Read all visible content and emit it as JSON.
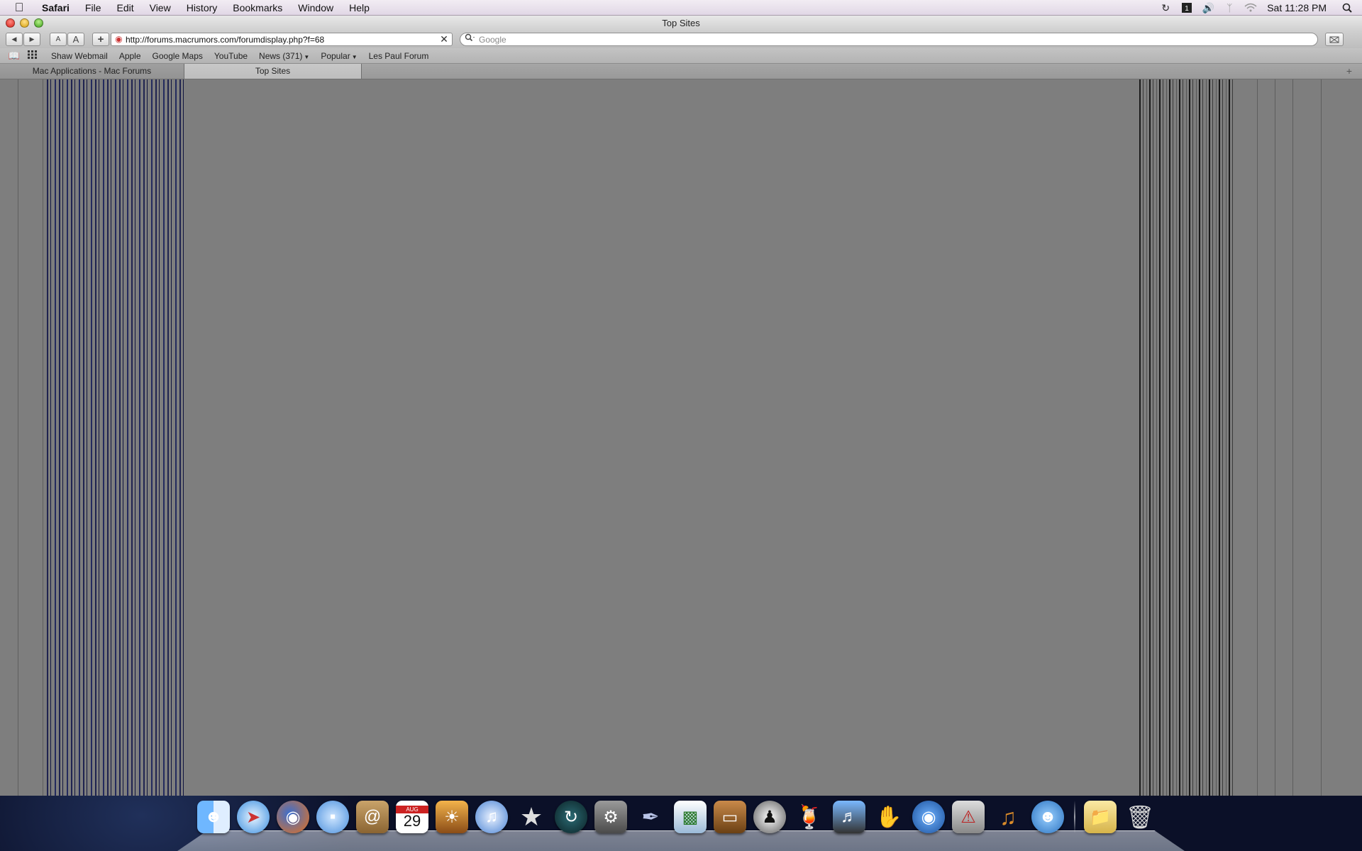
{
  "menubar": {
    "app_name": "Safari",
    "items": [
      "File",
      "Edit",
      "View",
      "History",
      "Bookmarks",
      "Window",
      "Help"
    ],
    "clock": "Sat 11:28 PM",
    "status_icons": [
      "time-machine-icon",
      "spaces-icon",
      "volume-icon",
      "bluetooth-icon",
      "wifi-icon",
      "spotlight-icon"
    ]
  },
  "window": {
    "title": "Top Sites"
  },
  "toolbar": {
    "back_label": "◀",
    "forward_label": "▶",
    "text_smaller_label": "A",
    "text_larger_label": "A",
    "add_bookmark_label": "+",
    "url": "http://forums.macrumors.com/forumdisplay.php?f=68",
    "search_placeholder": "Google"
  },
  "bookmarks": {
    "items": [
      "Shaw Webmail",
      "Apple",
      "Google Maps",
      "YouTube",
      "News (371)",
      "Popular",
      "Les Paul Forum"
    ]
  },
  "tabs": [
    {
      "label": "Mac Applications - Mac Forums",
      "active": false
    },
    {
      "label": "Top Sites",
      "active": true
    }
  ],
  "dock": {
    "items": [
      "finder-icon",
      "safari-icon",
      "firefox-icon",
      "ichat-icon",
      "address-book-icon",
      "ical-icon",
      "iphoto-icon",
      "itunes-icon",
      "imovie-icon",
      "time-machine-icon",
      "system-preferences-icon",
      "script-editor-icon",
      "numbers-icon",
      "keynote-icon",
      "adium-icon",
      "cocktail-icon",
      "iworld-icon",
      "quicksilver-icon",
      "image-capture-icon",
      "utility-icon",
      "garageband-icon",
      "messenger-icon",
      "documents-folder-icon",
      "trash-icon"
    ],
    "ical_date": "29",
    "ical_month": "AUG"
  }
}
